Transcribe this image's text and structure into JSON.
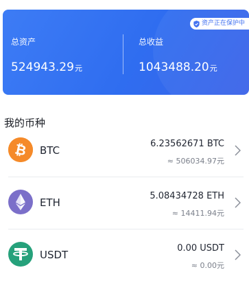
{
  "asset_card": {
    "badge_text": "资产正在保护中",
    "total_assets_label": "总资产",
    "total_assets_value": "524943.29",
    "total_assets_unit": "元",
    "total_income_label": "总收益",
    "total_income_value": "1043488.20",
    "total_income_unit": "元",
    "gradient_colors": [
      "#3d7cf5",
      "#3a63e8"
    ]
  },
  "coins_section": {
    "title": "我的币种",
    "coins": [
      {
        "symbol": "BTC",
        "amount": "6.23562671 BTC",
        "cny_value": "≈ 506034.97元",
        "icon": "bitcoin-icon",
        "color": "#f7931a"
      },
      {
        "symbol": "ETH",
        "amount": "5.08434728 ETH",
        "cny_value": "≈ 14411.94元",
        "icon": "ethereum-icon",
        "color": "#7b6fc9"
      },
      {
        "symbol": "USDT",
        "amount": "0.00 USDT",
        "cny_value": "≈ 0.00元",
        "icon": "tether-icon",
        "color": "#26a17b"
      }
    ]
  }
}
